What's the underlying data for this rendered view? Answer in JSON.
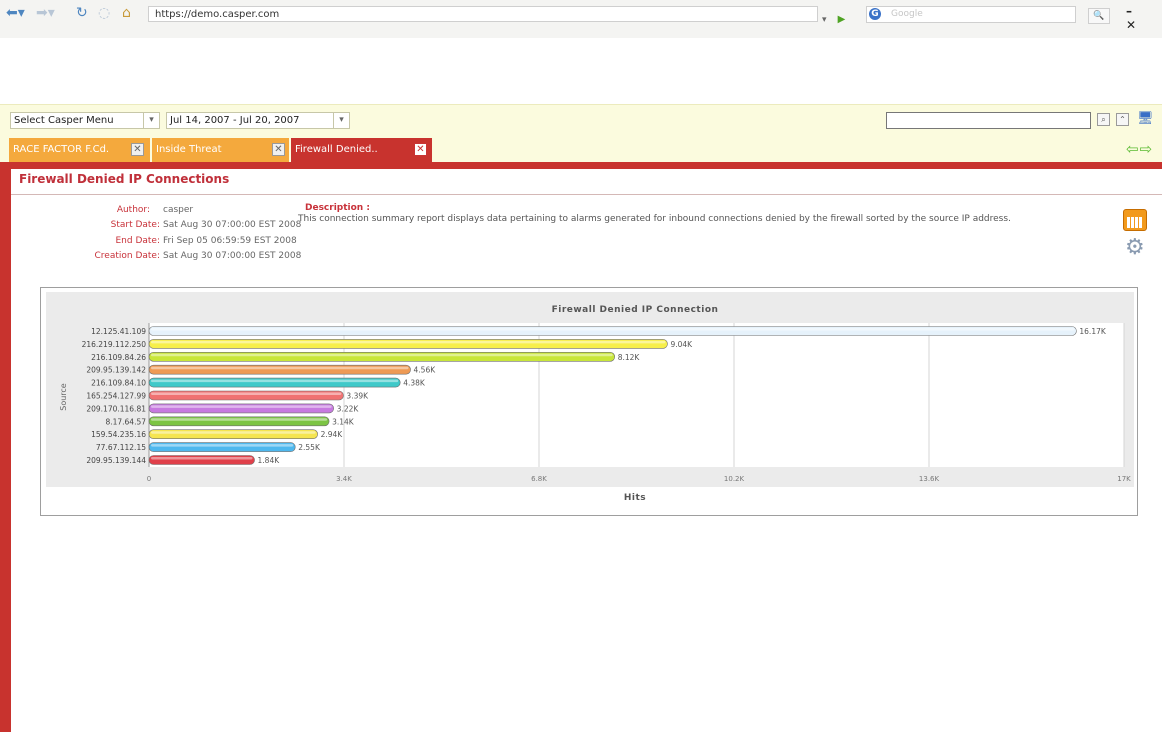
{
  "browser": {
    "url": "https://demo.casper.com",
    "search_placeholder": "Google",
    "search_engine_glyph": "G",
    "window_controls": "– ✕"
  },
  "toolbar": {
    "menu_select": "Select Casper Menu",
    "date_range": "Jul 14, 2007 - Jul 20, 2007",
    "search_value": ""
  },
  "tabs": [
    {
      "label": "RACE FACTOR F.Cd.",
      "color": "#f4a93d"
    },
    {
      "label": "Inside Threat",
      "color": "#f4a93d"
    },
    {
      "label": "Firewall Denied..",
      "color": "#c8332e"
    }
  ],
  "report": {
    "title": "Firewall Denied IP Connections",
    "meta": [
      {
        "label": "Author:",
        "value": "casper"
      },
      {
        "label": "Start Date:",
        "value": "Sat Aug 30 07:00:00 EST 2008"
      },
      {
        "label": "End Date:",
        "value": "Fri Sep 05 06:59:59 EST 2008"
      },
      {
        "label": "Creation Date:",
        "value": "Sat Aug 30 07:00:00 EST 2008"
      }
    ],
    "description_label": "Description :",
    "description": "This connection summary report displays data pertaining to alarms generated for inbound connections denied by the firewall sorted by the source IP address."
  },
  "icons": {
    "calendar": "calendar-icon",
    "tools": "tools-icon"
  },
  "colors": {
    "accent_red": "#c8332e",
    "tab_orange": "#f4a93d",
    "toolbar_yellow": "#fbfbde"
  },
  "chart_data": {
    "type": "bar",
    "orientation": "horizontal",
    "title": "Firewall Denied IP Connection",
    "xlabel": "Hits",
    "ylabel": "Source",
    "xlim": [
      0,
      17000
    ],
    "x_ticks": [
      0,
      3400,
      6800,
      10200,
      13600,
      17000
    ],
    "x_tick_labels": [
      "0",
      "3.4K",
      "6.8K",
      "10.2K",
      "13.6K",
      "17K"
    ],
    "grid": "vertical",
    "categories": [
      "12.125.41.109",
      "216.219.112.250",
      "216.109.84.26",
      "209.95.139.142",
      "216.109.84.10",
      "165.254.127.99",
      "209.170.116.81",
      "8.17.64.57",
      "159.54.235.16",
      "77.67.112.15",
      "209.95.139.144"
    ],
    "values": [
      16170,
      9040,
      8120,
      4560,
      4380,
      3390,
      3220,
      3140,
      2940,
      2550,
      1840
    ],
    "value_labels": [
      "16.17K",
      "9.04K",
      "8.12K",
      "4.56K",
      "4.38K",
      "3.39K",
      "3.22K",
      "3.14K",
      "2.94K",
      "2.55K",
      "1.84K"
    ],
    "bar_colors": [
      "#e6f2fb",
      "#f7ef4a",
      "#c8e63a",
      "#ee9a55",
      "#3fc9c9",
      "#f07272",
      "#c77ae0",
      "#7cc444",
      "#f5e550",
      "#4eb8ee",
      "#e0404a"
    ]
  }
}
